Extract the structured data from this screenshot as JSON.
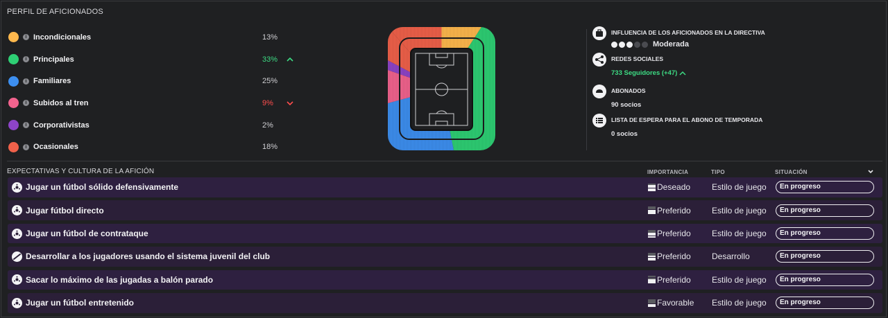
{
  "profile": {
    "title": "PERFIL DE AFICIONADOS",
    "segments": [
      {
        "label": "Incondicionales",
        "pct": "13%",
        "color": "#ffb84d",
        "trend": "none"
      },
      {
        "label": "Principales",
        "pct": "33%",
        "color": "#2ecf74",
        "trend": "up"
      },
      {
        "label": "Familiares",
        "pct": "25%",
        "color": "#3d8ff0",
        "trend": "none"
      },
      {
        "label": "Subidos al tren",
        "pct": "9%",
        "color": "#f2638e",
        "trend": "down"
      },
      {
        "label": "Corporativistas",
        "pct": "2%",
        "color": "#8e44c8",
        "trend": "none"
      },
      {
        "label": "Ocasionales",
        "pct": "18%",
        "color": "#f0614a",
        "trend": "none"
      }
    ]
  },
  "stats": {
    "influence": {
      "heading": "INFLUENCIA DE LOS AFICIONADOS EN LA DIRECTIVA",
      "level": 3,
      "max": 5,
      "value": "Moderada"
    },
    "social": {
      "heading": "REDES SOCIALES",
      "value": "733 Seguidores (+47)"
    },
    "season": {
      "heading": "ABONADOS",
      "value": "90 socios"
    },
    "waitlist": {
      "heading": "LISTA DE ESPERA PARA EL ABONO DE TEMPORADA",
      "value": "0 socios"
    }
  },
  "expectations": {
    "title": "EXPECTATIVAS Y CULTURA DE LA AFICIÓN",
    "columns": {
      "importance": "IMPORTANCIA",
      "type": "TIPO",
      "status": "SITUACIÓN"
    },
    "rows": [
      {
        "text": "Jugar un fútbol sólido defensivamente",
        "icon": "ball-icon",
        "importance": "Deseado",
        "importance_level": 4,
        "type": "Estilo de juego",
        "status": "En progreso"
      },
      {
        "text": "Jugar fútbol directo",
        "icon": "ball-icon",
        "importance": "Preferido",
        "importance_level": 3,
        "type": "Estilo de juego",
        "status": "En progreso"
      },
      {
        "text": "Jugar un fútbol de contrataque",
        "icon": "ball-icon",
        "importance": "Preferido",
        "importance_level": 3,
        "type": "Estilo de juego",
        "status": "En progreso"
      },
      {
        "text": "Desarrollar a los jugadores usando el sistema juvenil del club",
        "icon": "youth-icon",
        "importance": "Preferido",
        "importance_level": 3,
        "type": "Desarrollo",
        "status": "En progreso"
      },
      {
        "text": "Sacar lo máximo de las jugadas a balón parado",
        "icon": "ball-icon",
        "importance": "Preferido",
        "importance_level": 3,
        "type": "Estilo de juego",
        "status": "En progreso"
      },
      {
        "text": "Jugar un fútbol entretenido",
        "icon": "ball-icon",
        "importance": "Favorable",
        "importance_level": 2,
        "type": "Estilo de juego",
        "status": "En progreso"
      }
    ]
  }
}
